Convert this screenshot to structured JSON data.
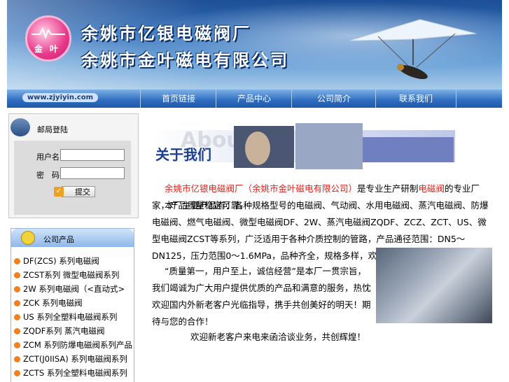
{
  "header": {
    "title_line1": "余姚市亿银电磁阀厂",
    "title_line2": "余姚市金叶磁电有限公司",
    "logo_text": [
      "金",
      "叶"
    ]
  },
  "nav": {
    "url": "www.zjyiyin.com",
    "items": [
      "首页链接",
      "产品中心",
      "公司简介",
      "联系我们"
    ]
  },
  "login": {
    "title": "邮局登陆",
    "user_label": "用户名:",
    "pass_label": "密　码:",
    "submit_label": "提交"
  },
  "products": {
    "title": "公司产品",
    "items": [
      "DF(ZCS) 系列电磁阀",
      "ZCST系列 微型电磁阀系列",
      "2W 系列电磁阀（<直动式>",
      "ZCK 系列电磁阀",
      "US 系列全塑料电磁阀系列",
      "ZQDF系列 蒸汽电磁阀",
      "ZCM 系列防爆电磁阀系列产品",
      "ZCT(J0IISA) 系列电磁阀系列",
      "ZCTS 系列全塑料电磁阀系列"
    ]
  },
  "about": {
    "banner_text": "关于我们",
    "watermark": "About",
    "p1_company": "余姚市亿银电磁阀厂（余姚市金叶磁电有限公司）",
    "p1_mid": "是专业生产研制",
    "p1_red": "电磁阀",
    "p1_tail": "的专业厂家，产品质量稳定可靠。",
    "p2": "本厂主要产品有：各种规格型号的电磁阀、气动阀、水用电磁阀、蒸汽电磁阀、防爆电磁阀、燃气电磁阀、微型电磁阀DF、2W、蒸汽电磁阀ZQDF、ZCZ、ZCT、US、微型电磁阀ZCST等系列，广泛适用于各种介质控制的管路，产品通径范围：DN5～DN125，压力范围0～1.6MPa，品种齐全，规格多样，欢迎来电来函咨询洽谈。",
    "p3": "“质量第一，用户至上，诚信经营”是本厂一贯宗旨，我们竭诚为广大用户提供优质的产品和满意的服务，热忱欢迎国内外新老客户光临指导，携手共创美好的明天！期待与您的合作！",
    "footer": "欢迎新老客户来电来函洽谈业务，共创辉煌！"
  },
  "colors": {
    "accent_red": "#e0201a",
    "nav_blue": "#2e6cc0",
    "bullet_orange": "#f08020"
  }
}
